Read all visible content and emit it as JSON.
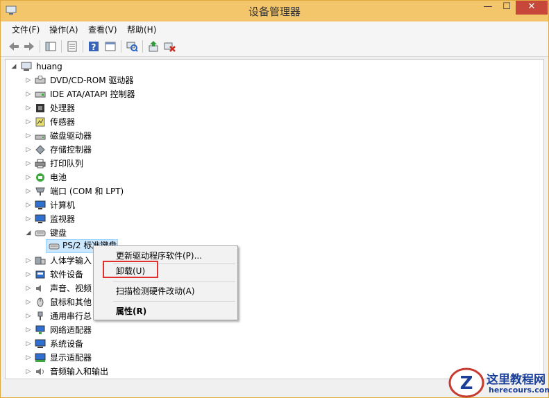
{
  "window": {
    "title": "设备管理器"
  },
  "window_controls": {
    "minimize": "—",
    "maximize": "☐",
    "close": "✕"
  },
  "menu": [
    "文件(F)",
    "操作(A)",
    "查看(V)",
    "帮助(H)"
  ],
  "tree": {
    "root": "huang",
    "categories": [
      {
        "label": "DVD/CD-ROM 驱动器",
        "icon": "dvd-drive-icon"
      },
      {
        "label": "IDE ATA/ATAPI 控制器",
        "icon": "ide-controller-icon"
      },
      {
        "label": "处理器",
        "icon": "processor-icon"
      },
      {
        "label": "传感器",
        "icon": "sensor-icon"
      },
      {
        "label": "磁盘驱动器",
        "icon": "disk-drive-icon"
      },
      {
        "label": "存储控制器",
        "icon": "storage-controller-icon"
      },
      {
        "label": "打印队列",
        "icon": "printer-icon"
      },
      {
        "label": "电池",
        "icon": "battery-icon"
      },
      {
        "label": "端口 (COM 和 LPT)",
        "icon": "port-icon"
      },
      {
        "label": "计算机",
        "icon": "computer-icon"
      },
      {
        "label": "监视器",
        "icon": "monitor-icon"
      },
      {
        "label": "键盘",
        "icon": "keyboard-icon"
      },
      {
        "label": "人体学输入",
        "icon": "hid-icon"
      },
      {
        "label": "软件设备",
        "icon": "software-device-icon"
      },
      {
        "label": "声音、视频",
        "icon": "sound-icon"
      },
      {
        "label": "鼠标和其他",
        "icon": "mouse-icon"
      },
      {
        "label": "通用串行总",
        "icon": "usb-icon"
      },
      {
        "label": "网络适配器",
        "icon": "network-adapter-icon"
      },
      {
        "label": "系统设备",
        "icon": "system-device-icon"
      },
      {
        "label": "显示适配器",
        "icon": "display-adapter-icon"
      },
      {
        "label": "音频输入和输出",
        "icon": "audio-io-icon"
      }
    ],
    "selected_device": "PS/2 标准键盘"
  },
  "context_menu": {
    "update_driver": "更新驱动程序软件(P)...",
    "uninstall": "卸载(U)",
    "scan_hardware": "扫描检测硬件改动(A)",
    "properties": "属性(R)"
  },
  "watermark": {
    "title": "这里教程网",
    "url": "herecours.com"
  },
  "colors": {
    "titlebar": "#f4c66c",
    "close_button": "#c7483b",
    "selection": "#cce8ff",
    "highlight_box": "#e03030"
  }
}
